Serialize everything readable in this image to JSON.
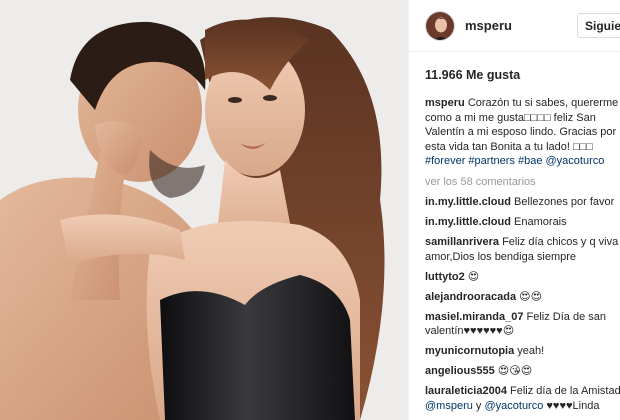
{
  "post": {
    "username": "msperu",
    "follow_label": "Siguien",
    "likes": "11.966 Me gusta",
    "caption": {
      "username": "msperu",
      "text": "Corazón tu si sabes, quererme como a mi me gusta□□□□ feliz San Valentín a mi esposo lindo. Gracias por esta vida tan Bonita a tu lado! □□□",
      "hashtags": [
        "#forever",
        "#partners",
        "#bae"
      ],
      "mention": "@yacoturco"
    },
    "view_all": "ver los 58 comentarios",
    "comments": [
      {
        "user": "in.my.little.cloud",
        "text": "Bellezones por favor"
      },
      {
        "user": "in.my.little.cloud",
        "text": "Enamorais"
      },
      {
        "user": "samillanrivera",
        "text": "Feliz día chicos y q viva el amor,Dios los bendiga siempre"
      },
      {
        "user": "luttyto2",
        "text": "😍"
      },
      {
        "user": "alejandrooracada",
        "text": "😍😍"
      },
      {
        "user": "masiel.miranda_07",
        "text": "Feliz Día de san valentín♥♥♥♥♥♥😍"
      },
      {
        "user": "myunicornutopia",
        "text": "yeah!"
      },
      {
        "user": "angelious555",
        "text": "😍😘😍"
      },
      {
        "user": "lauraleticia2004",
        "text": "Feliz día de la Amistad",
        "mention1": "@msperu",
        "joiner": " y ",
        "mention2": "@yacoturco",
        "tail": " ♥♥♥♥Linda"
      }
    ]
  },
  "colors": {
    "link": "#003569",
    "muted": "#999999",
    "text": "#262626"
  },
  "icons": {
    "avatar": "profile-avatar"
  }
}
